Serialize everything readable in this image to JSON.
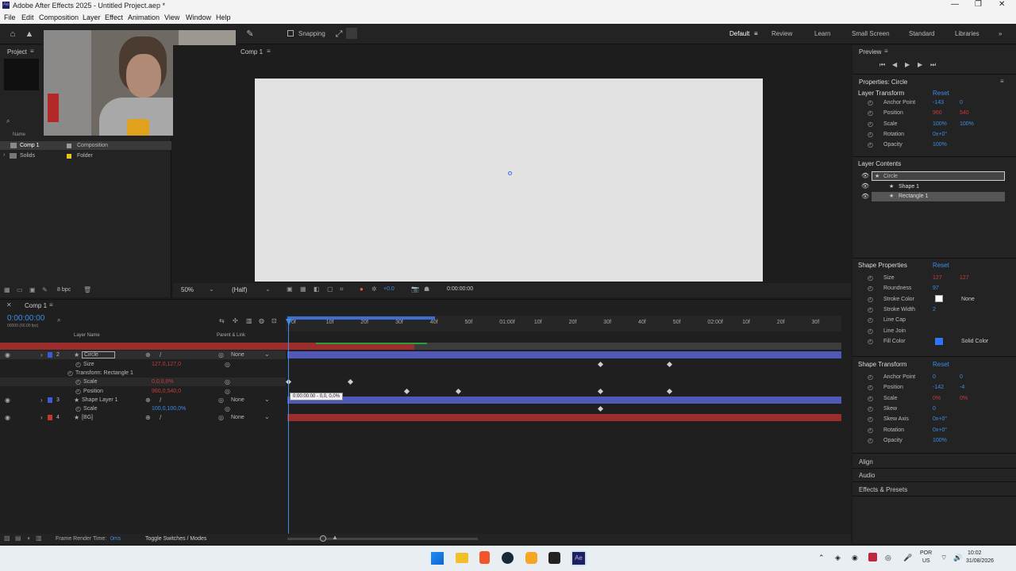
{
  "app": {
    "title": "Adobe After Effects 2025 - Untitled Project.aep *"
  },
  "menu": [
    "File",
    "Edit",
    "Composition",
    "Layer",
    "Effect",
    "Animation",
    "View",
    "Window",
    "Help"
  ],
  "toolbar": {
    "snapping": "Snapping",
    "workspaces": [
      "Default",
      "Review",
      "Learn",
      "Small Screen",
      "Standard",
      "Libraries"
    ]
  },
  "project": {
    "tab": "Project",
    "col_name": "Name",
    "col_type": "Type",
    "items": [
      {
        "name": "Comp 1",
        "type": "Composition"
      },
      {
        "name": "Solids",
        "type": "Folder"
      }
    ],
    "bpc": "8 bpc"
  },
  "comp": {
    "tab": "Comp 1",
    "zoom": "50%",
    "resolution": "(Half)",
    "time": "0:00:00:00",
    "exposure": "+0.0"
  },
  "preview": {
    "title": "Preview"
  },
  "properties": {
    "title": "Properties: Circle",
    "layer_transform": "Layer Transform",
    "reset": "Reset",
    "lt_rows": [
      {
        "label": "Anchor Point",
        "v1": "-143",
        "v2": "0"
      },
      {
        "label": "Position",
        "v1": "960",
        "v2": "540"
      },
      {
        "label": "Scale",
        "v1": "100%",
        "v2": "100%"
      },
      {
        "label": "Rotation",
        "v1": "0x+0°",
        "v2": ""
      },
      {
        "label": "Opacity",
        "v1": "100%",
        "v2": ""
      }
    ],
    "layer_contents": "Layer Contents",
    "contents": [
      "Circle",
      "Shape 1",
      "Rectangle 1"
    ],
    "shape_props": "Shape Properties",
    "sp_rows": [
      {
        "label": "Size",
        "v1": "127",
        "v2": "127"
      },
      {
        "label": "Roundness",
        "v1": "97",
        "v2": ""
      },
      {
        "label": "Stroke Color",
        "v1": "",
        "v2": "None"
      },
      {
        "label": "Stroke Width",
        "v1": "2",
        "v2": ""
      },
      {
        "label": "Line Cap",
        "v1": "",
        "v2": ""
      },
      {
        "label": "Line Join",
        "v1": "",
        "v2": ""
      },
      {
        "label": "Fill Color",
        "v1": "",
        "v2": "Solid Color"
      }
    ],
    "shape_transform": "Shape Transform",
    "st_rows": [
      {
        "label": "Anchor Point",
        "v1": "0",
        "v2": "0"
      },
      {
        "label": "Position",
        "v1": "-142",
        "v2": "-4"
      },
      {
        "label": "Scale",
        "v1": "0%",
        "v2": "0%"
      },
      {
        "label": "Skew",
        "v1": "0",
        "v2": ""
      },
      {
        "label": "Skew Axis",
        "v1": "0x+0°",
        "v2": ""
      },
      {
        "label": "Rotation",
        "v1": "0x+0°",
        "v2": ""
      },
      {
        "label": "Opacity",
        "v1": "100%",
        "v2": ""
      }
    ],
    "sections": [
      "Align",
      "Audio",
      "Effects & Presets"
    ]
  },
  "timeline": {
    "tab": "Comp 1",
    "time": "0:00:00:00",
    "fps": "00000 (60.00 fps)",
    "hdr_layer": "Layer Name",
    "hdr_parent": "Parent & Link",
    "ticks": [
      "0f",
      "10f",
      "20f",
      "30f",
      "40f",
      "50f",
      "01:00f",
      "10f",
      "20f",
      "30f",
      "40f",
      "50f",
      "02:00f",
      "10f",
      "20f",
      "30f"
    ],
    "layers": [
      {
        "num": "1",
        "name": "iPhone 17 Pro",
        "parent": "None",
        "color": "#c0392b"
      },
      {
        "num": "2",
        "name": "Circle",
        "parent": "None",
        "color": "#3d5bd9"
      },
      {
        "sub": "Size",
        "val": "127,0,127,0"
      },
      {
        "sub": "Transform: Rectangle 1",
        "val": ""
      },
      {
        "sub": "Scale",
        "val": "0,0,0,0%"
      },
      {
        "sub": "Position",
        "val": "960,0,540,0"
      },
      {
        "num": "3",
        "name": "Shape Layer 1",
        "parent": "None",
        "color": "#3d5bd9"
      },
      {
        "sub": "Scale",
        "val": "100,0,100,0%"
      },
      {
        "num": "4",
        "name": "[BG]",
        "parent": "None",
        "color": "#c0392b"
      }
    ],
    "tooltip": "0:00:00:00 - 0,0, 0,0%",
    "footer_render": "Frame Render Time:",
    "footer_render_val": "0ms",
    "footer_toggle": "Toggle Switches / Modes"
  },
  "taskbar": {
    "lang1": "POR",
    "lang2": "US",
    "time": "10:02",
    "date": "31/08/2026"
  }
}
